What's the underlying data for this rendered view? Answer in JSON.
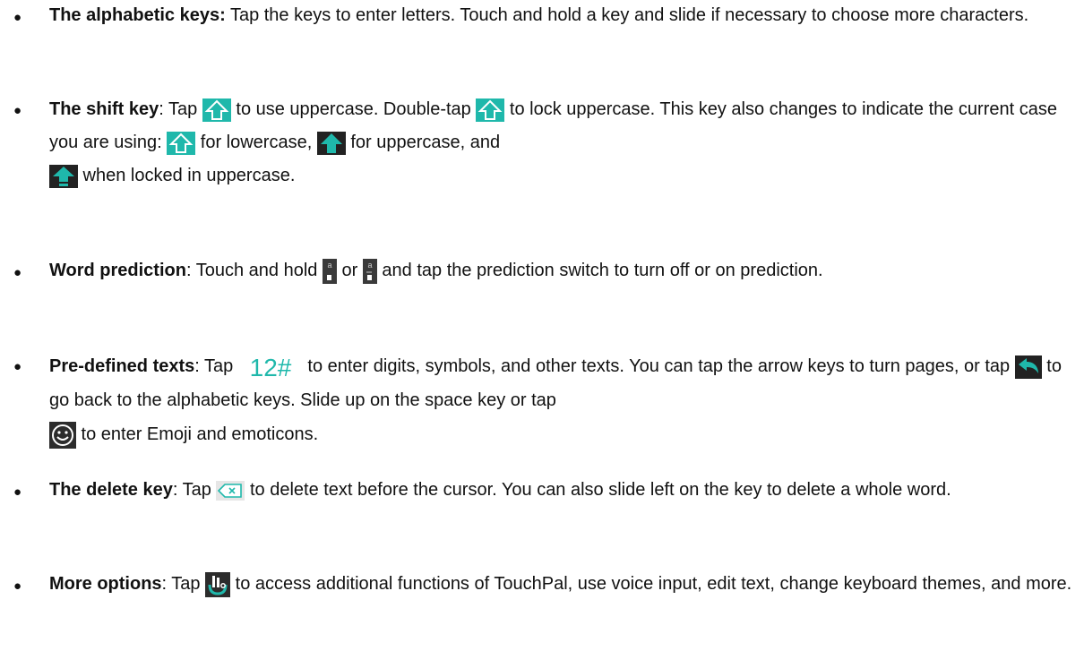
{
  "items": [
    {
      "title": "The alphabetic keys:",
      "parts": [
        " Tap the keys to enter letters. Touch and hold a key and slide if necessary to choose more characters."
      ]
    },
    {
      "title": "The shift key",
      "parts": [
        ": Tap ",
        " to use uppercase. Double-tap ",
        " to lock uppercase. This key also changes to indicate the current case you are using: ",
        " for lowercase, ",
        " for uppercase, and ",
        " when locked in uppercase."
      ]
    },
    {
      "title": "Word prediction",
      "parts": [
        ": Touch and hold ",
        " or ",
        " and tap the prediction switch to turn off or on prediction."
      ],
      "key_letter": "a"
    },
    {
      "title": "Pre-defined texts",
      "parts": [
        ": Tap ",
        " to enter digits, symbols, and other texts. You can tap the arrow keys to turn pages, or tap ",
        " to go back to the alphabetic keys. Slide up on the space key or tap ",
        " to enter Emoji and emoticons."
      ],
      "digits_key_label": "12#"
    },
    {
      "title": "The delete key",
      "parts": [
        ": Tap ",
        " to delete text before the cursor. You can also slide left on the key to delete a whole word."
      ]
    },
    {
      "title": "More options",
      "parts": [
        ": Tap ",
        " to access additional functions of TouchPal, use voice input, edit text, change keyboard themes, and more."
      ]
    }
  ],
  "colors": {
    "accent": "#1fb8ab",
    "key_dark": "#3a3a3a",
    "text": "#111111"
  },
  "icons": [
    "shift-outline-icon",
    "shift-filled-icon",
    "shift-locked-icon",
    "prediction-key-icon",
    "digits-key-icon",
    "back-arrow-icon",
    "emoji-icon",
    "delete-key-icon",
    "touchpal-menu-icon"
  ]
}
